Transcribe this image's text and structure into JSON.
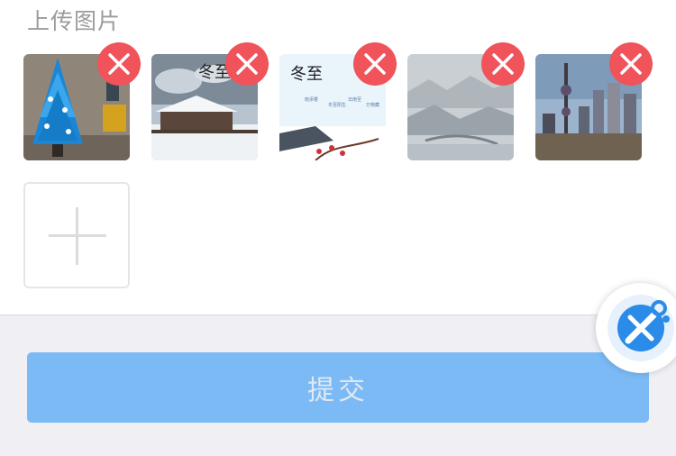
{
  "upload": {
    "title": "上传图片",
    "images": [
      {
        "name": "christmas-tree-photo"
      },
      {
        "name": "winter-village-photo",
        "caption": "冬至"
      },
      {
        "name": "winter-solstice-poster",
        "caption": "冬至",
        "poem": [
          "晓添香",
          "冬至阳生",
          "日南至",
          "万物藏"
        ]
      },
      {
        "name": "snowy-landscape-painting"
      },
      {
        "name": "city-skyline-photo"
      }
    ],
    "delete_icon": "close-icon",
    "add_icon": "plus-icon"
  },
  "actions": {
    "submit_label": "提交"
  },
  "floating_button": {
    "icon": "wrench-screwdriver-icon"
  },
  "colors": {
    "accent": "#7bbaf5",
    "delete": "#f0535a",
    "background": "#efeff4"
  }
}
